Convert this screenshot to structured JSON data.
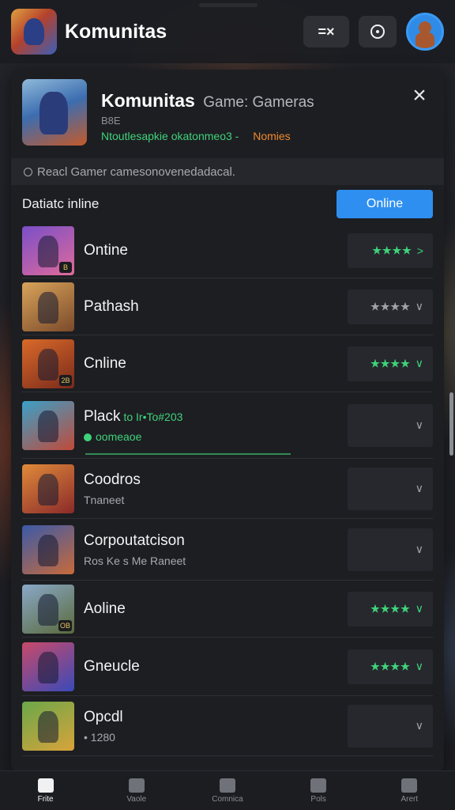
{
  "app": {
    "title": "Komunitas",
    "menu_label": "=×"
  },
  "panel": {
    "title": "Komunitas",
    "title_sub": "Game: Gameras",
    "small": "B8E",
    "meta_green": "Ntoutlesapkie okatonmeo3 -",
    "meta_orange": "Nomies",
    "notice": "Reacl Gamer camesonovenedadacal.",
    "section_title": "Datiatc inline",
    "online_button": "Online"
  },
  "items": [
    {
      "title": "Ontine",
      "sub": "",
      "inline": "",
      "stars": "★★★★",
      "chev": ">",
      "badge": "B",
      "colors": [
        "#7a4fc8",
        "#e06a9a"
      ],
      "muted": false
    },
    {
      "title": "Pathash",
      "sub": "",
      "inline": "",
      "stars": "★★★★",
      "chev": "∨",
      "badge": "",
      "colors": [
        "#d9a35a",
        "#7a4a2a"
      ],
      "muted": true
    },
    {
      "title": "Cnline",
      "sub": "",
      "inline": "",
      "stars": "★★★★",
      "chev": "∨",
      "badge": "2B",
      "colors": [
        "#d96a2a",
        "#7a2a1a"
      ],
      "muted": false
    },
    {
      "title": "Plack",
      "sub": "oomeaoe",
      "inline": "to Ir•To#203",
      "stars": "",
      "chev": "∨",
      "badge": "",
      "colors": [
        "#3aa0c8",
        "#c04a3a"
      ],
      "muted": true
    },
    {
      "title": "Coodros",
      "sub": "Tnaneet",
      "inline": "",
      "stars": "",
      "chev": "∨",
      "badge": "",
      "colors": [
        "#e08a3a",
        "#8a2a2a"
      ],
      "muted": true
    },
    {
      "title": "Corpoutatcison",
      "sub": "Ros Ke s Me Raneet",
      "inline": "",
      "stars": "",
      "chev": "∨",
      "badge": "",
      "colors": [
        "#3a5aa8",
        "#c86a3a"
      ],
      "muted": true
    },
    {
      "title": "Aoline",
      "sub": "",
      "inline": "",
      "stars": "★★★★",
      "chev": "∨",
      "badge": "OB",
      "colors": [
        "#8aa8c8",
        "#5a6a3a"
      ],
      "muted": false
    },
    {
      "title": "Gneucle",
      "sub": "",
      "inline": "",
      "stars": "★★★★",
      "chev": "∨",
      "badge": "",
      "colors": [
        "#c84a6a",
        "#3a4ab8"
      ],
      "muted": false
    },
    {
      "title": "Opcdl",
      "sub": "• 1280",
      "inline": "",
      "stars": "",
      "chev": "∨",
      "badge": "",
      "colors": [
        "#6aa84a",
        "#d9a33a"
      ],
      "muted": false
    }
  ],
  "nav": [
    {
      "label": "Frite",
      "icon": "home-icon",
      "active": true
    },
    {
      "label": "Vaole",
      "icon": "flag-icon",
      "active": false
    },
    {
      "label": "Comnica",
      "icon": "search-icon",
      "active": false
    },
    {
      "label": "Pols",
      "icon": "gallery-icon",
      "active": false
    },
    {
      "label": "Arert",
      "icon": "menu-icon",
      "active": false
    }
  ]
}
